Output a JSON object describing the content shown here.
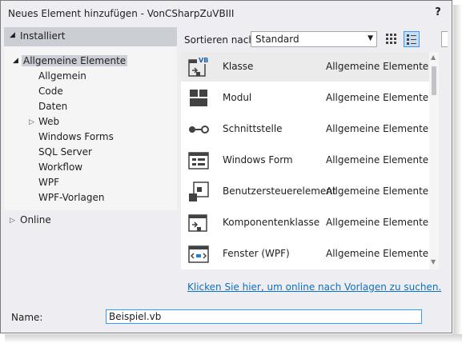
{
  "window": {
    "title": "Neues Element hinzufügen - VonCSharpZuVBIII",
    "help_label": "?"
  },
  "tree": {
    "header": "Installiert",
    "root": "Allgemeine Elemente",
    "children": [
      "Allgemein",
      "Code",
      "Daten",
      "Web",
      "Windows Forms",
      "SQL Server",
      "Workflow",
      "WPF",
      "WPF-Vorlagen"
    ],
    "online": "Online"
  },
  "sort": {
    "label": "Sortieren nach:",
    "value": "Standard"
  },
  "templates": [
    {
      "name": "Klasse",
      "category": "Allgemeine Elemente",
      "icon": "class-icon",
      "badge": "VB"
    },
    {
      "name": "Modul",
      "category": "Allgemeine Elemente",
      "icon": "module-icon"
    },
    {
      "name": "Schnittstelle",
      "category": "Allgemeine Elemente",
      "icon": "interface-icon"
    },
    {
      "name": "Windows Form",
      "category": "Allgemeine Elemente",
      "icon": "windows-form-icon"
    },
    {
      "name": "Benutzersteuerelement",
      "category": "Allgemeine Elemente",
      "icon": "user-control-icon"
    },
    {
      "name": "Komponentenklasse",
      "category": "Allgemeine Elemente",
      "icon": "component-class-icon"
    },
    {
      "name": "Fenster (WPF)",
      "category": "Allgemeine Elemente",
      "icon": "wpf-window-icon"
    }
  ],
  "online_link": "Klicken Sie hier, um online nach Vorlagen zu suchen.",
  "footer": {
    "name_label": "Name:",
    "name_value": "Beispiel.vb"
  },
  "colors": {
    "accent": "#3399ff",
    "link": "#0e70c0",
    "selection": "#ccced6"
  }
}
